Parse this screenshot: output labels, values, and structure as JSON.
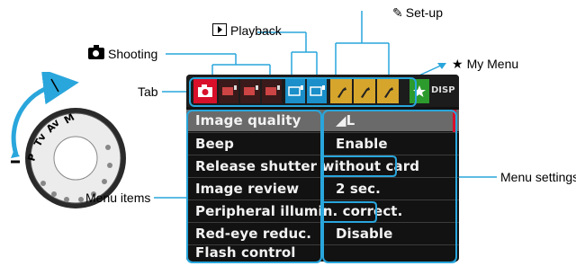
{
  "callouts": {
    "playback": "Playback",
    "setup": "Set-up",
    "shooting": "Shooting",
    "my_menu": "My Menu",
    "tab": "Tab",
    "menu_settings": "Menu settings",
    "menu_items": "Menu items"
  },
  "screen": {
    "disp_label": "DISP",
    "menu": [
      {
        "label": "Image quality",
        "value": "◢L"
      },
      {
        "label": "Beep",
        "value": "Enable"
      },
      {
        "label": "Release shutter without card",
        "value": ""
      },
      {
        "label": "Image review",
        "value": "2 sec."
      },
      {
        "label": "Peripheral illumin. correct.",
        "value": ""
      },
      {
        "label": "Red-eye reduc.",
        "value": "Disable"
      },
      {
        "label": "Flash control",
        "value": ""
      }
    ]
  },
  "dial": {
    "modes": [
      "M",
      "Av",
      "Tv",
      "P"
    ]
  },
  "colors": {
    "callout_line": "#29a6dc",
    "shooting_tab": "#d8102a",
    "playback_tab": "#1a8fc9",
    "setup_tab": "#d6a52c",
    "mymenu_tab": "#2c9a2c"
  }
}
